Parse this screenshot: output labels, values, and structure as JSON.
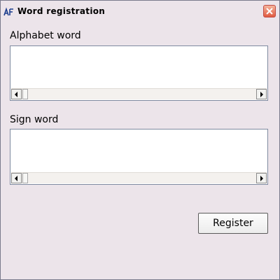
{
  "window": {
    "title": "Word registration",
    "icons": {
      "app": "app-logo-icon",
      "close": "close-icon"
    }
  },
  "alphabet_word": {
    "label": "Alphabet word",
    "value": ""
  },
  "sign_word": {
    "label": "Sign word",
    "value": ""
  },
  "actions": {
    "register_label": "Register"
  },
  "colors": {
    "window_bg": "#ece4ea",
    "close_button": "#e05a40",
    "field_bg": "#ffffff"
  }
}
